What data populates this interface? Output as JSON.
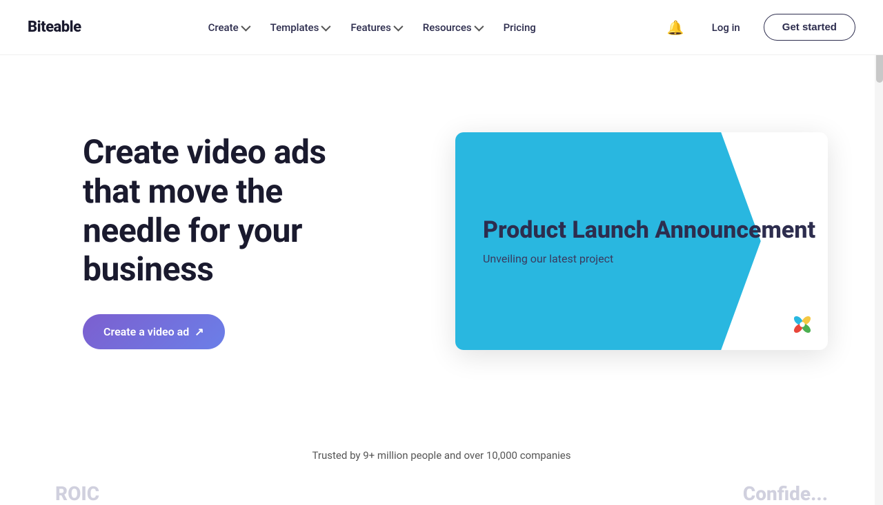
{
  "brand": {
    "name": "Biteable"
  },
  "nav": {
    "links": [
      {
        "label": "Create",
        "has_dropdown": true
      },
      {
        "label": "Templates",
        "has_dropdown": true
      },
      {
        "label": "Features",
        "has_dropdown": true
      },
      {
        "label": "Resources",
        "has_dropdown": true
      },
      {
        "label": "Pricing",
        "has_dropdown": false
      }
    ],
    "login_label": "Log in",
    "get_started_label": "Get started"
  },
  "hero": {
    "title": "Create video ads that move the needle for your business",
    "cta_label": "Create a video ad",
    "cta_arrow": "↗"
  },
  "video_card": {
    "title": "Product Launch Announcement",
    "subtitle": "Unveiling our latest project"
  },
  "trust": {
    "text": "Trusted by 9+ million people and over 10,000 companies"
  },
  "bottom_partial": {
    "left_text": "ROIC",
    "right_text": "Confide..."
  },
  "colors": {
    "brand_blue": "#29b7e0",
    "brand_purple_start": "#7c5fcf",
    "brand_purple_end": "#6b7fe8",
    "dark_navy": "#2d2d4e"
  }
}
